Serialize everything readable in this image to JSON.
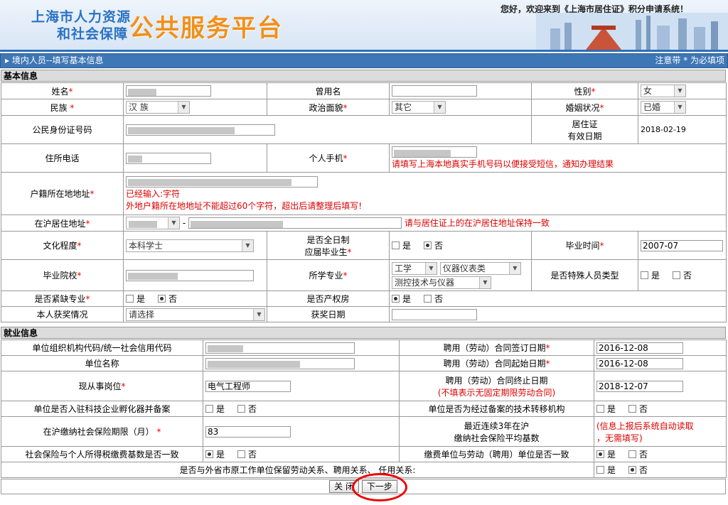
{
  "header": {
    "logo_line1": "上海市人力资源",
    "logo_line2": "和社会保障",
    "logo_big": "公共服务平台",
    "welcome": "您好，欢迎来到《上海市居住证》积分申请系统！"
  },
  "titlebar": {
    "title": "境内人员--填写基本信息",
    "hint": "注意带 * 为必填项"
  },
  "basic": {
    "section": "基本信息",
    "name_label": "姓名",
    "former_name_label": "曾用名",
    "gender_label": "性别",
    "gender_value": "女",
    "ethnic_label": "民族",
    "ethnic_value": "汉 族",
    "political_label": "政治面貌",
    "political_value": "其它",
    "marital_label": "婚姻状况",
    "marital_value": "已婚",
    "id_label": "公民身份证号码",
    "residence_permit_label_1": "居住证",
    "residence_permit_label_2": "有效日期",
    "residence_permit_value": "2018-02-19",
    "home_phone_label": "住所电话",
    "mobile_label": "个人手机",
    "mobile_note": "请填写上海本地真实手机号码以便接受短信，通知办理结果",
    "hukou_label": "户籍所在地地址",
    "hukou_entered": "已经输入:字符",
    "hukou_note": "外地户籍所在地地址不能超过60个字符，超出后请整理后填写!",
    "shanghai_addr_label": "在沪居住地址",
    "addr_dash": "-",
    "shanghai_addr_note": "请与居住证上的在沪居住地址保持一致",
    "education_label": "文化程度",
    "education_value": "本科学士",
    "fulltime_label_1": "是否全日制",
    "fulltime_label_2": "应届毕业生",
    "yes": "是",
    "no": "否",
    "graduation_label": "毕业时间",
    "graduation_value": "2007-07",
    "school_label": "毕业院校",
    "major_label": "所学专业",
    "major_cat": "工学",
    "major_sub": "仪器仪表类",
    "major_name": "测控技术与仪器",
    "special_label": "是否特殊人员类型",
    "shortage_label": "是否紧缺专业",
    "property_label": "是否产权房",
    "awards_label": "本人获奖情况",
    "awards_value": "请选择",
    "award_date_label": "获奖日期"
  },
  "employment": {
    "section": "就业信息",
    "org_code_label": "单位组织机构代码/统一社会信用代码",
    "contract_sign_label": "聘用（劳动）合同签订日期",
    "contract_sign_value": "2016-12-08",
    "company_label": "单位名称",
    "contract_start_label": "聘用（劳动）合同起始日期",
    "contract_start_value": "2016-12-08",
    "position_label": "现从事岗位",
    "position_value": "电气工程师",
    "contract_end_label": "聘用（劳动）合同终止日期",
    "contract_end_note": "(不填表示无固定期限劳动合同)",
    "contract_end_value": "2018-12-07",
    "incubator_label": "单位是否入驻科技企业孵化器并备案",
    "tech_transfer_label": "单位是否为经过备案的技术转移机构",
    "insurance_months_label": "在沪缴纳社会保险期限（月）",
    "insurance_months_value": "83",
    "avg_base_label_1": "最近连续3年在沪",
    "avg_base_label_2": "缴纳社会保险平均基数",
    "avg_base_note_1": "(信息上报后系统自动读取",
    "avg_base_note_2": "，无需填写)",
    "base_consistent_label": "社会保险与个人所得税缴费基数是否一致",
    "payer_consistent_label": "缴费单位与劳动（聘用）单位是否一致",
    "retain_label": "是否与外省市原工作单位保留劳动关系、聘用关系、 任用关系:"
  },
  "buttons": {
    "close": "关 闭",
    "next": "下一步"
  }
}
